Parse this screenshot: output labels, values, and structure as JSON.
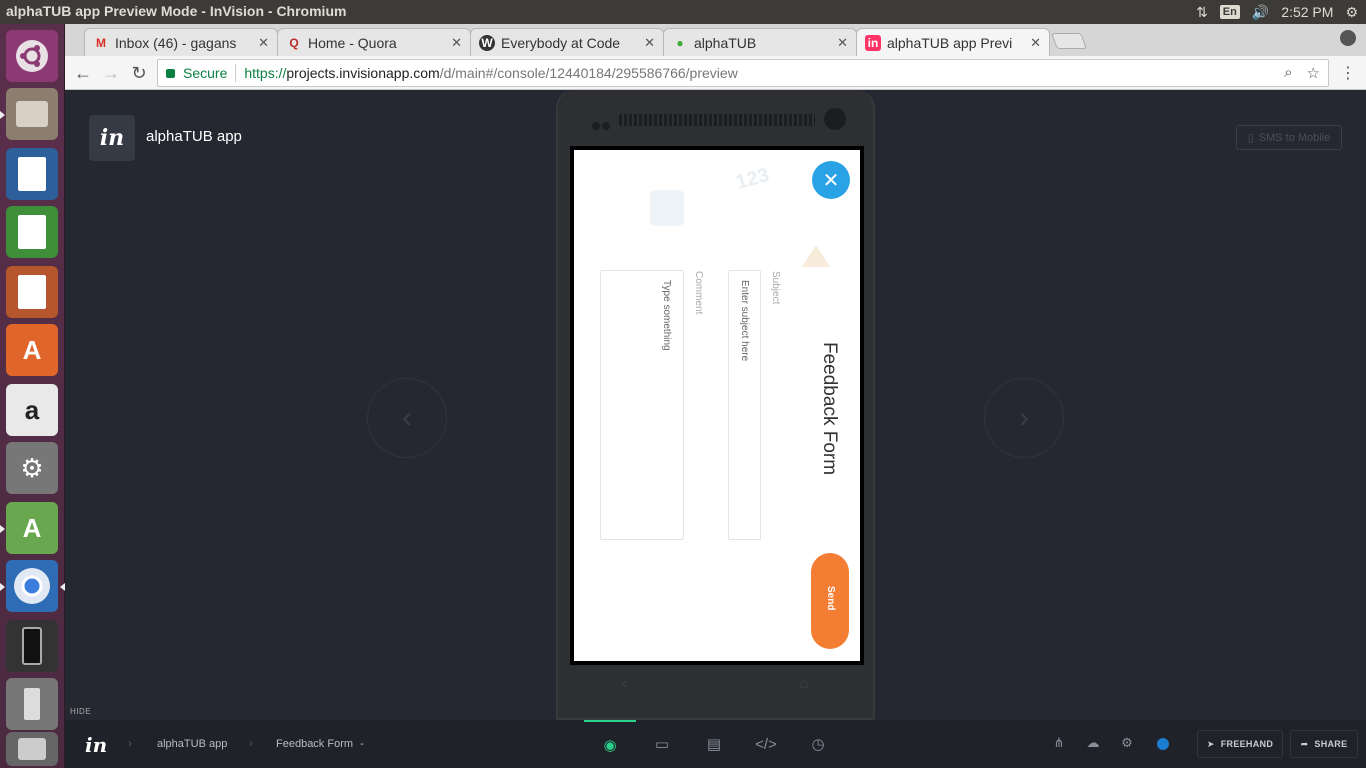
{
  "os": {
    "window_title": "alphaTUB app Preview Mode - InVision - Chromium",
    "keyboard_layout": "En",
    "clock": "2:52 PM"
  },
  "launcher": {
    "apps": [
      {
        "name": "ubuntu-dash-icon"
      },
      {
        "name": "files-app-icon"
      },
      {
        "name": "writer-app-icon"
      },
      {
        "name": "calc-app-icon"
      },
      {
        "name": "impress-app-icon"
      },
      {
        "name": "software-center-icon"
      },
      {
        "name": "amazon-app-icon"
      },
      {
        "name": "system-settings-icon"
      },
      {
        "name": "android-studio-icon"
      },
      {
        "name": "chromium-app-icon"
      },
      {
        "name": "phone-app-icon"
      },
      {
        "name": "usb-drive-icon"
      },
      {
        "name": "trash-icon"
      }
    ]
  },
  "browser": {
    "tabs": [
      {
        "label": "Inbox (46) - gagans",
        "favicon": "gmail-icon"
      },
      {
        "label": "Home - Quora",
        "favicon": "quora-icon"
      },
      {
        "label": "Everybody at Code",
        "favicon": "wordpress-icon"
      },
      {
        "label": "alphaTUB",
        "favicon": "alphatub-icon"
      },
      {
        "label": "alphaTUB app Previ",
        "favicon": "invision-icon"
      }
    ],
    "address": {
      "secure_label": "Secure",
      "scheme": "https://",
      "host": "projects.invisionapp.com",
      "path": "/d/main#/console/12440184/295586766/preview"
    }
  },
  "invision": {
    "project_logo": "in",
    "project_name": "alphaTUB app",
    "sms_label": "SMS to Mobile",
    "form": {
      "title": "Feedback Form",
      "subject_label": "Subject",
      "subject_placeholder": "Enter subject here",
      "comment_label": "Comment",
      "comment_placeholder": "Type something",
      "send_label": "Send",
      "doodle_text": "123"
    },
    "bottombar": {
      "hide_label": "HIDE",
      "logo": "in",
      "crumb_project": "alphaTUB app",
      "crumb_screen": "Feedback Form",
      "crumb_dash": "-",
      "freehand_label": "FREEHAND",
      "share_label": "SHARE",
      "active_color": "#2bd18a"
    }
  }
}
